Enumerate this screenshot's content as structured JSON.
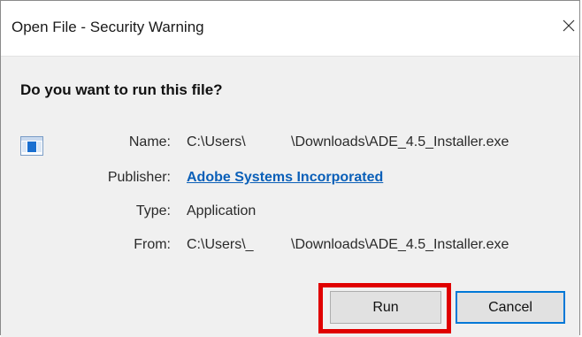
{
  "window": {
    "title": "Open File - Security Warning",
    "close_symbol": "✕"
  },
  "dialog": {
    "question": "Do you want to run this file?",
    "file_icon": "application-window-icon",
    "fields": {
      "name": {
        "label": "Name:",
        "value_prefix": "C:\\Users\\",
        "value_suffix": "\\Downloads\\ADE_4.5_Installer.exe"
      },
      "publisher": {
        "label": "Publisher:",
        "value": "Adobe Systems Incorporated"
      },
      "type": {
        "label": "Type:",
        "value": "Application"
      },
      "from": {
        "label": "From:",
        "value_prefix": "C:\\Users\\_",
        "value_suffix": "\\Downloads\\ADE_4.5_Installer.exe"
      }
    }
  },
  "buttons": {
    "run_label": "Run",
    "cancel_label": "Cancel"
  },
  "colors": {
    "link": "#0a5fb8",
    "highlight": "#e00000",
    "focus_border": "#0078d7",
    "content_bg": "#f0f0f0"
  }
}
